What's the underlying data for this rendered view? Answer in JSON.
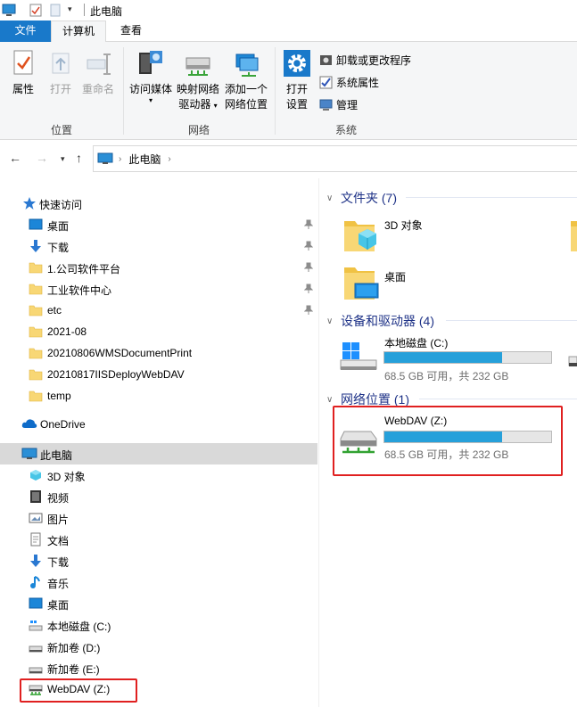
{
  "window": {
    "title": "此电脑"
  },
  "tabs": {
    "file": "文件",
    "computer": "计算机",
    "view": "查看"
  },
  "ribbon": {
    "location": {
      "label": "位置",
      "properties": "属性",
      "open": "打开",
      "rename": "重命名"
    },
    "network": {
      "label": "网络",
      "media": "访问媒体",
      "map_drive_1": "映射网络",
      "map_drive_2": "驱动器",
      "add_location_1": "添加一个",
      "add_location_2": "网络位置"
    },
    "system": {
      "label": "系统",
      "open_settings_1": "打开",
      "open_settings_2": "设置",
      "uninstall": "卸载或更改程序",
      "sys_props": "系统属性",
      "manage": "管理"
    }
  },
  "address": {
    "path": "此电脑"
  },
  "nav": {
    "quick_access": "快速访问",
    "quick_items": [
      {
        "label": "桌面",
        "icon": "desktop-icon",
        "pinned": true
      },
      {
        "label": "下载",
        "icon": "download-icon",
        "pinned": true
      },
      {
        "label": "1.公司软件平台",
        "icon": "folder-icon",
        "pinned": true
      },
      {
        "label": "工业软件中心",
        "icon": "folder-icon",
        "pinned": true
      },
      {
        "label": "etc",
        "icon": "folder-icon",
        "pinned": true
      },
      {
        "label": "2021-08",
        "icon": "folder-icon",
        "pinned": false
      },
      {
        "label": "20210806WMSDocumentPrint",
        "icon": "folder-icon",
        "pinned": false
      },
      {
        "label": "20210817IISDeployWebDAV",
        "icon": "folder-icon",
        "pinned": false
      },
      {
        "label": "temp",
        "icon": "folder-icon",
        "pinned": false
      }
    ],
    "onedrive": "OneDrive",
    "this_pc": "此电脑",
    "pc_items": [
      {
        "label": "3D 对象",
        "icon": "3d-objects-icon"
      },
      {
        "label": "视频",
        "icon": "video-icon"
      },
      {
        "label": "图片",
        "icon": "pictures-icon"
      },
      {
        "label": "文档",
        "icon": "documents-icon"
      },
      {
        "label": "下载",
        "icon": "download-icon"
      },
      {
        "label": "音乐",
        "icon": "music-icon"
      },
      {
        "label": "桌面",
        "icon": "desktop-icon"
      },
      {
        "label": "本地磁盘 (C:)",
        "icon": "local-disk-icon"
      },
      {
        "label": "新加卷 (D:)",
        "icon": "drive-icon"
      },
      {
        "label": "新加卷 (E:)",
        "icon": "drive-icon"
      },
      {
        "label": "WebDAV (Z:)",
        "icon": "network-drive-icon"
      }
    ]
  },
  "content": {
    "folders_header": "文件夹 (7)",
    "folders": [
      {
        "label": "3D 对象"
      },
      {
        "label": "桌面"
      }
    ],
    "devices_header": "设备和驱动器 (4)",
    "local_disk": {
      "name": "本地磁盘 (C:)",
      "free": "68.5 GB 可用，共 232 GB",
      "used_fraction": 0.705
    },
    "network_header": "网络位置 (1)",
    "webdav": {
      "name": "WebDAV (Z:)",
      "free": "68.5 GB 可用，共 232 GB",
      "used_fraction": 0.705
    }
  },
  "colors": {
    "accent": "#1979ca",
    "progress": "#26a0da",
    "highlight": "#e02020",
    "section_header": "#1e3287"
  }
}
